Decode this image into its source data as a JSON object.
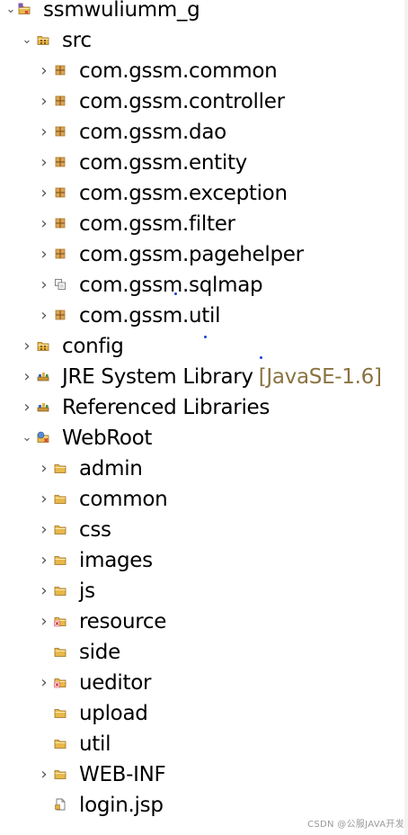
{
  "tree": {
    "items": [
      {
        "label": "ssmwuliumm_g",
        "depth": 0,
        "expandable": true,
        "expanded": true,
        "icon": "project-icon"
      },
      {
        "label": "src",
        "depth": 1,
        "expandable": true,
        "expanded": true,
        "icon": "source-folder-icon"
      },
      {
        "label": "com.gssm.common",
        "depth": 2,
        "expandable": true,
        "expanded": false,
        "icon": "package-icon"
      },
      {
        "label": "com.gssm.controller",
        "depth": 2,
        "expandable": true,
        "expanded": false,
        "icon": "package-icon"
      },
      {
        "label": "com.gssm.dao",
        "depth": 2,
        "expandable": true,
        "expanded": false,
        "icon": "package-icon"
      },
      {
        "label": "com.gssm.entity",
        "depth": 2,
        "expandable": true,
        "expanded": false,
        "icon": "package-icon"
      },
      {
        "label": "com.gssm.exception",
        "depth": 2,
        "expandable": true,
        "expanded": false,
        "icon": "package-icon"
      },
      {
        "label": "com.gssm.filter",
        "depth": 2,
        "expandable": true,
        "expanded": false,
        "icon": "package-icon"
      },
      {
        "label": "com.gssm.pagehelper",
        "depth": 2,
        "expandable": true,
        "expanded": false,
        "icon": "package-icon"
      },
      {
        "label": "com.gssm.sqlmap",
        "depth": 2,
        "expandable": true,
        "expanded": false,
        "icon": "package-resource-icon"
      },
      {
        "label": "com.gssm.util",
        "depth": 2,
        "expandable": true,
        "expanded": false,
        "icon": "package-icon"
      },
      {
        "label": "config",
        "depth": 1,
        "expandable": true,
        "expanded": false,
        "icon": "source-folder-icon"
      },
      {
        "label": "JRE System Library",
        "qualifier": "[JavaSE-1.6]",
        "depth": 1,
        "expandable": true,
        "expanded": false,
        "icon": "library-icon"
      },
      {
        "label": "Referenced Libraries",
        "depth": 1,
        "expandable": true,
        "expanded": false,
        "icon": "library-icon"
      },
      {
        "label": "WebRoot",
        "depth": 1,
        "expandable": true,
        "expanded": true,
        "icon": "web-folder-icon"
      },
      {
        "label": "admin",
        "depth": 2,
        "expandable": true,
        "expanded": false,
        "icon": "folder-icon"
      },
      {
        "label": "common",
        "depth": 2,
        "expandable": true,
        "expanded": false,
        "icon": "folder-icon"
      },
      {
        "label": "css",
        "depth": 2,
        "expandable": true,
        "expanded": false,
        "icon": "folder-icon"
      },
      {
        "label": "images",
        "depth": 2,
        "expandable": true,
        "expanded": false,
        "icon": "folder-icon"
      },
      {
        "label": "js",
        "depth": 2,
        "expandable": true,
        "expanded": false,
        "icon": "folder-icon"
      },
      {
        "label": "resource",
        "depth": 2,
        "expandable": true,
        "expanded": false,
        "icon": "folder-error-icon"
      },
      {
        "label": "side",
        "depth": 2,
        "expandable": false,
        "expanded": false,
        "icon": "folder-icon"
      },
      {
        "label": "ueditor",
        "depth": 2,
        "expandable": true,
        "expanded": false,
        "icon": "folder-error-icon"
      },
      {
        "label": "upload",
        "depth": 2,
        "expandable": false,
        "expanded": false,
        "icon": "folder-icon"
      },
      {
        "label": "util",
        "depth": 2,
        "expandable": false,
        "expanded": false,
        "icon": "folder-icon"
      },
      {
        "label": "WEB-INF",
        "depth": 2,
        "expandable": true,
        "expanded": false,
        "icon": "folder-icon"
      },
      {
        "label": "login.jsp",
        "depth": 2,
        "expandable": false,
        "expanded": false,
        "icon": "jsp-file-icon"
      }
    ]
  },
  "watermark": "CSDN @公服JAVA开发",
  "colors": {
    "text": "#000000",
    "qualifier": "#8a7340",
    "folder": "#e8b84a",
    "package": "#b07a2a",
    "error": "#d23a3a",
    "stray_dots": "#1a3fd6"
  }
}
